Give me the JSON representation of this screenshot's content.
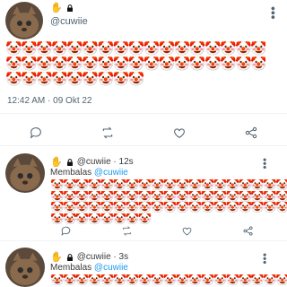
{
  "main_tweet": {
    "handle": "@cuwiie",
    "emoji_lines": [
      "🤡🤡🤡🤡🤡🤡🤡🤡🤡🤡🤡🤡🤡🤡🤡🤡🤡",
      "🤡🤡🤡🤡🤡🤡🤡🤡🤡🤡🤡🤡🤡🤡🤡🤡🤡",
      "🤡🤡🤡🤡🤡🤡🤡🤡🤡"
    ],
    "timestamp": "12:42 AM · 09 Okt 22",
    "icons": [
      "hand-icon",
      "lock-icon",
      "more-icon"
    ]
  },
  "replies": [
    {
      "handle_time": "@cuwiie · 12s",
      "reply_label": "Membalas",
      "reply_to": "@cuwiie",
      "emoji_lines": [
        "🤡🤡🤡🤡🤡🤡🤡🤡🤡🤡🤡🤡🤡🤡🤡🤡🤡🤡🤡",
        "🤡🤡🤡🤡🤡🤡🤡🤡🤡🤡🤡🤡🤡🤡🤡🤡🤡🤡🤡",
        "🤡🤡🤡🤡🤡🤡🤡🤡🤡🤡🤡🤡🤡🤡🤡🤡🤡🤡🤡",
        "🤡🤡🤡🤡🤡🤡🤡🤡"
      ]
    },
    {
      "handle_time": "@cuwiie · 3s",
      "reply_label": "Membalas",
      "reply_to": "@cuwiie",
      "emoji_lines": [
        "🤡🤡🤡🤡🤡🤡🤡🤡🤡🤡🤡🤡🤡🤡🤡🤡🤡🤡🤡"
      ]
    }
  ],
  "action_icons": [
    "reply-icon",
    "retweet-icon",
    "like-icon",
    "share-icon"
  ]
}
